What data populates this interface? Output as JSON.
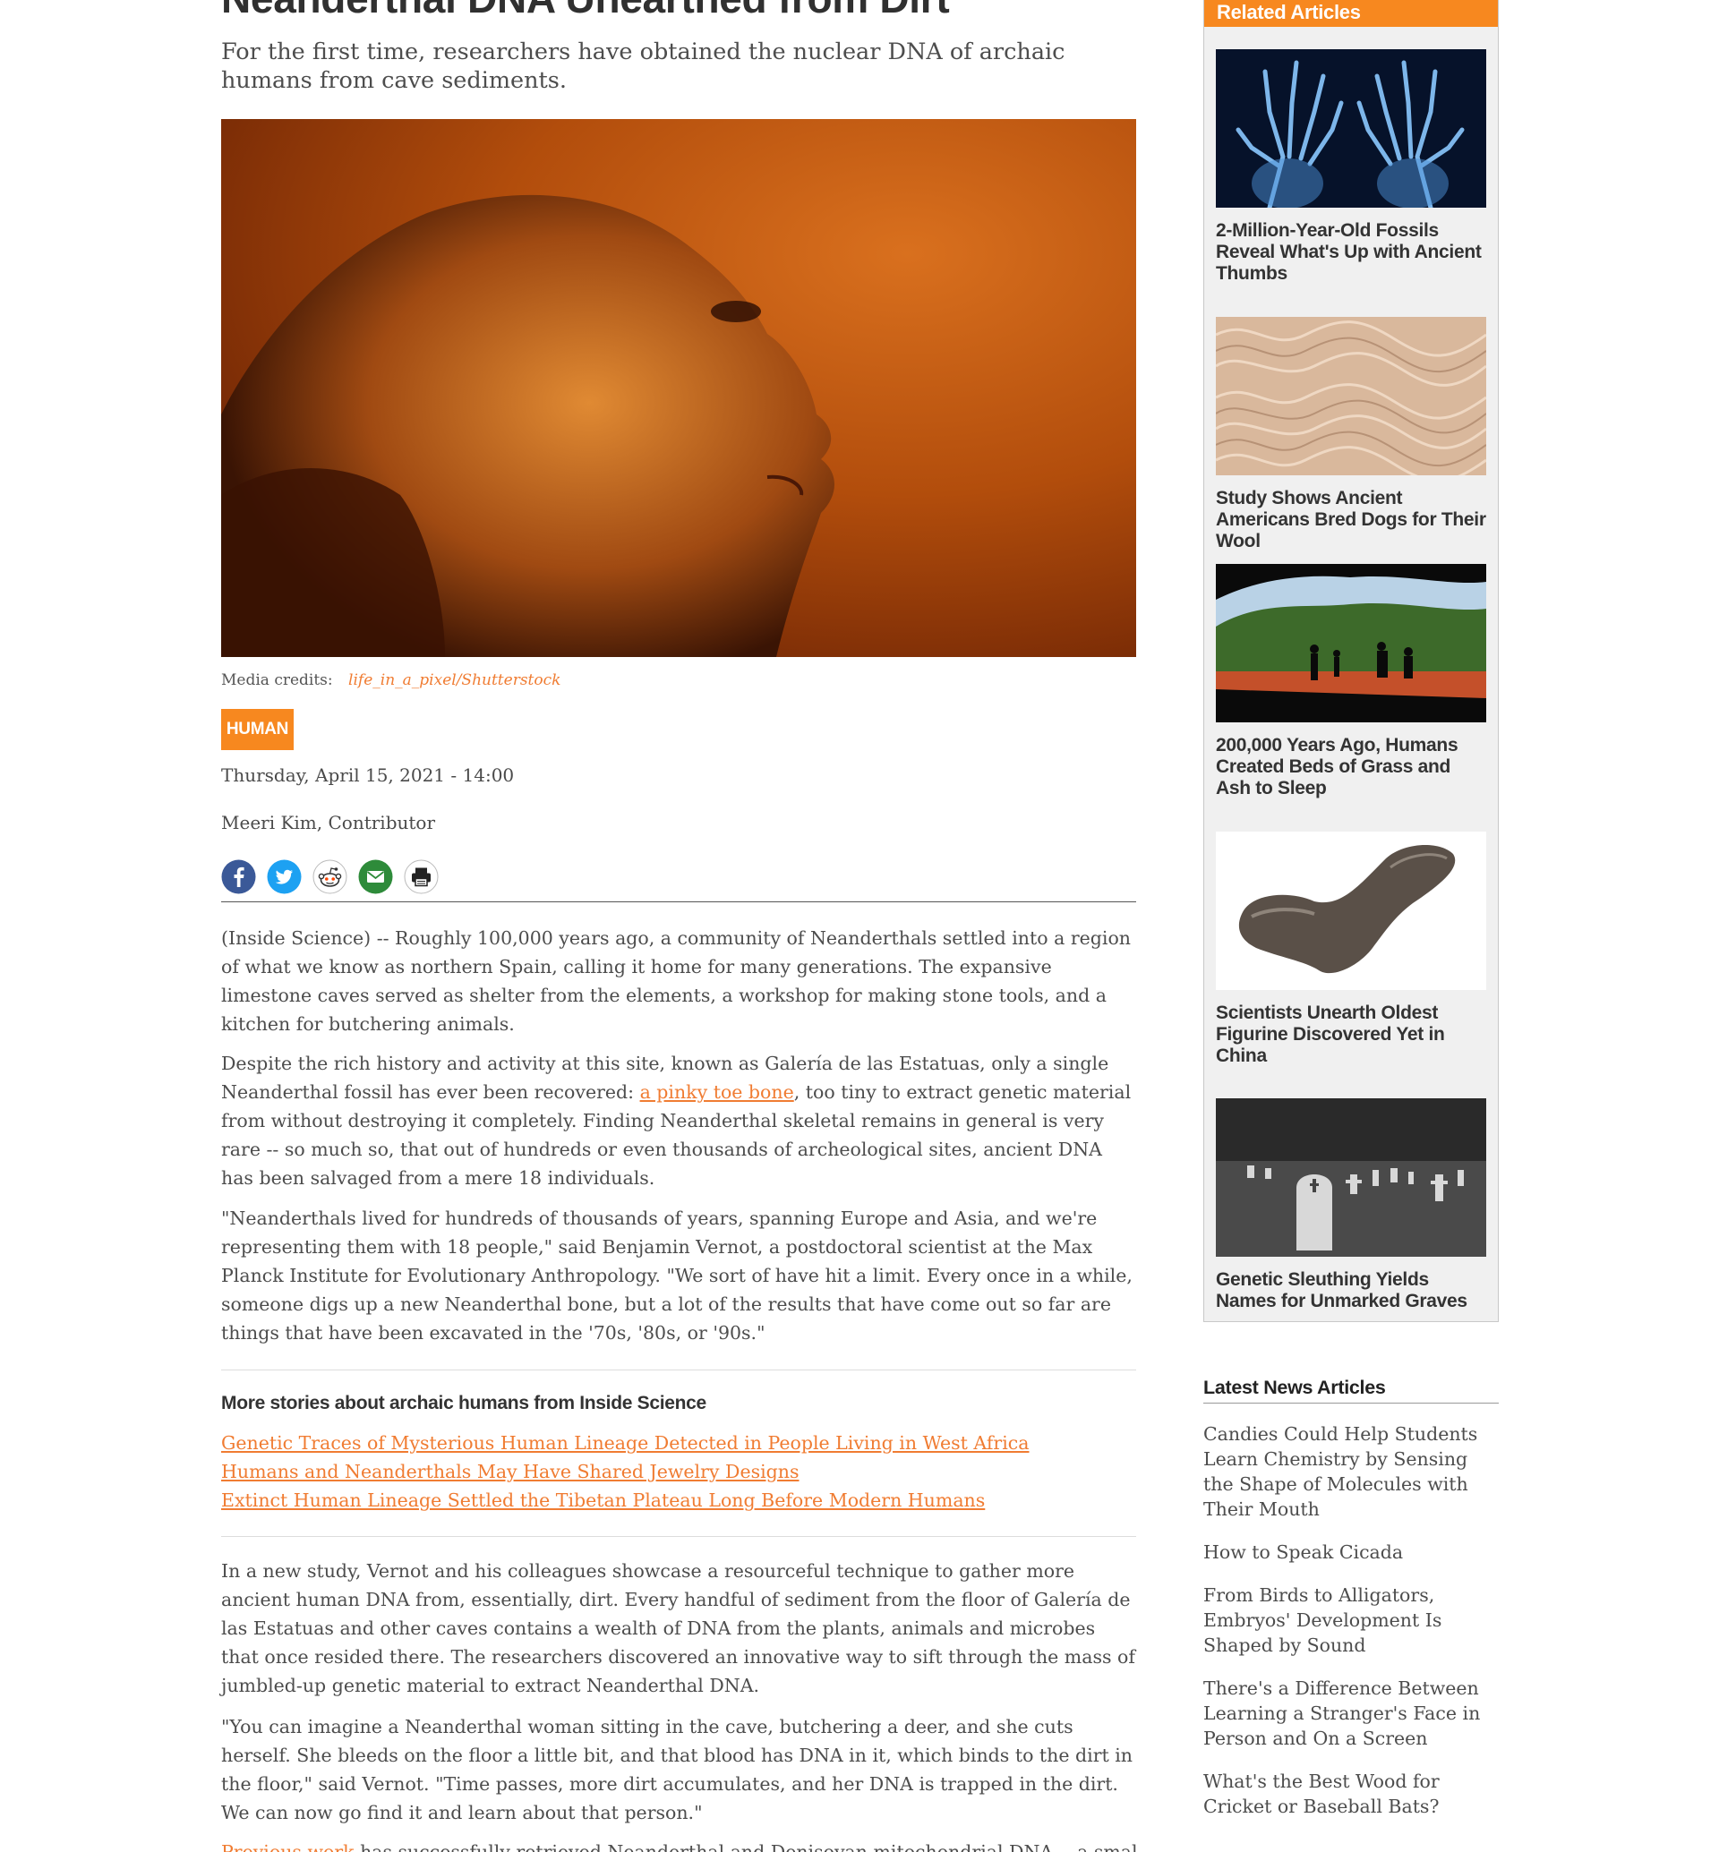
{
  "article": {
    "title": "Neanderthal DNA Unearthed from Dirt",
    "subtitle": "For the first time, researchers have obtained the nuclear DNA of archaic humans from cave sediments.",
    "hero_image": "reconstruction-head-of-archaic-human",
    "media_credits_label": "Media credits:",
    "media_credits_link": "life_in_a_pixel/Shutterstock",
    "tag": "HUMAN",
    "date": "Thursday, April 15, 2021 - 14:00",
    "author": "Meeri Kim, Contributor",
    "share_icons": [
      "facebook-icon",
      "twitter-icon",
      "reddit-icon",
      "email-icon",
      "print-icon"
    ],
    "p1": "(Inside Science) -- Roughly 100,000 years ago, a community of Neanderthals settled into a region of what we know as northern Spain, calling it home for many generations. The expansive limestone caves served as shelter from the elements, a workshop for making stone tools, and a kitchen for butchering animals.",
    "p2_before": "Despite the rich history and activity at this site, known as Galería de las Estatuas, only a single Neanderthal fossil has ever been recovered: ",
    "p2_link": "a pinky toe bone",
    "p2_after": ", too tiny to extract genetic material from without destroying it completely. Finding Neanderthal skeletal remains in general is very rare -- so much so, that out of hundreds or even thousands of archeological sites, ancient DNA has been salvaged from a mere 18 individuals.",
    "p3": "\"Neanderthals lived for hundreds of thousands of years, spanning Europe and Asia, and we're representing them with 18 people,\" said Benjamin Vernot, a postdoctoral scientist at the Max Planck Institute for Evolutionary Anthropology. \"We sort of have hit a limit. Every once in a while, someone digs up a new Neanderthal bone, but a lot of the results that have come out so far are things that have been excavated in the '70s, '80s, or '90s.\"",
    "more_title": "More stories about archaic humans from Inside Science",
    "more_links": [
      "Genetic Traces of Mysterious Human Lineage Detected in People Living in West Africa",
      "Humans and Neanderthals May Have Shared Jewelry Designs",
      "Extinct Human Lineage Settled the Tibetan Plateau Long Before Modern Humans"
    ],
    "p4": "In a new study, Vernot and his colleagues showcase a resourceful technique to gather more ancient human DNA from, essentially, dirt. Every handful of sediment from the floor of Galería de las Estatuas and other caves contains a wealth of DNA from the plants, animals and microbes that once resided there. The researchers discovered an innovative way to sift through the mass of jumbled-up genetic material to extract Neanderthal DNA.",
    "p5": "\"You can imagine a Neanderthal woman sitting in the cave, butchering a deer, and she cuts herself. She bleeds on the floor a little bit, and that blood has DNA in it, which binds to the dirt in the floor,\" said Vernot. \"Time passes, more dirt accumulates, and her DNA is trapped in the dirt. We can now go find it and learn about that person.\"",
    "p6_link": "Previous work",
    "p6_after": " has successfully retrieved Neanderthal and Denisovan mitochondrial DNA -- a small"
  },
  "sidebar": {
    "related_title": "Related Articles",
    "related": [
      {
        "title": "2-Million-Year-Old Fossils Reveal What's Up with Ancient Thumbs",
        "image": "xray-hands"
      },
      {
        "title": "Study Shows Ancient Americans Bred Dogs for Their Wool",
        "image": "wool-fibers"
      },
      {
        "title": "200,000 Years Ago, Humans Created Beds of Grass and Ash to Sleep",
        "image": "cave-silhouettes"
      },
      {
        "title": "Scientists Unearth Oldest Figurine Discovered Yet in China",
        "image": "bone-figurine"
      },
      {
        "title": "Genetic Sleuthing Yields Names for Unmarked Graves",
        "image": "cemetery"
      }
    ],
    "latest_title": "Latest News Articles",
    "latest": [
      "Candies Could Help Students Learn Chemistry by Sensing the Shape of Molecules with Their Mouth",
      "How to Speak Cicada",
      "From Birds to Alligators, Embryos' Development Is Shaped by Sound",
      "There's a Difference Between Learning a Stranger's Face in Person and On a Screen",
      "What's the Best Wood for Cricket or Baseball Bats?"
    ]
  },
  "colors": {
    "accent": "#f7881f",
    "link": "#f07c32"
  }
}
